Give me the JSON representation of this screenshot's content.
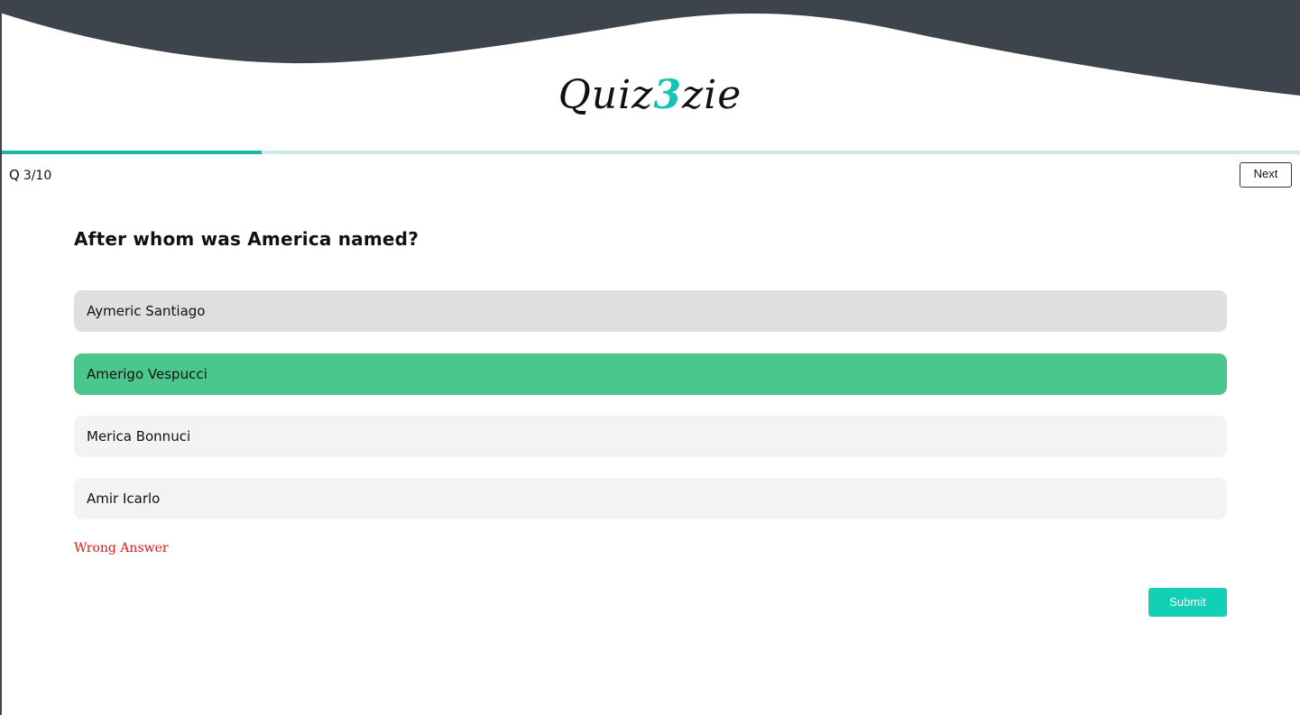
{
  "app": {
    "logo_prefix": "Quiz",
    "logo_accent": "3",
    "logo_suffix": "zie",
    "accent_color": "#19c2b4",
    "header_color": "#3d444b"
  },
  "progress": {
    "current": 3,
    "total": 10,
    "fraction": 0.2,
    "q_label": "Q",
    "counter_text": "3/10"
  },
  "toolbar": {
    "next_label": "Next"
  },
  "question": {
    "text": "After whom was America named?"
  },
  "options": [
    {
      "label": "Aymeric Santiago",
      "state": "selected"
    },
    {
      "label": "Amerigo Vespucci",
      "state": "correct"
    },
    {
      "label": "Merica Bonnuci",
      "state": "default"
    },
    {
      "label": "Amir Icarlo",
      "state": "default"
    }
  ],
  "feedback": {
    "text": "Wrong Answer",
    "color": "#e01818"
  },
  "actions": {
    "submit_label": "Submit",
    "submit_color": "#12d0b6"
  },
  "colors": {
    "correct_option": "#4bc68c",
    "selected_option": "#e0dfe0",
    "default_option": "#f3f3f3",
    "progress_fill": "#1bb5aa",
    "progress_track": "#c9ecea"
  }
}
